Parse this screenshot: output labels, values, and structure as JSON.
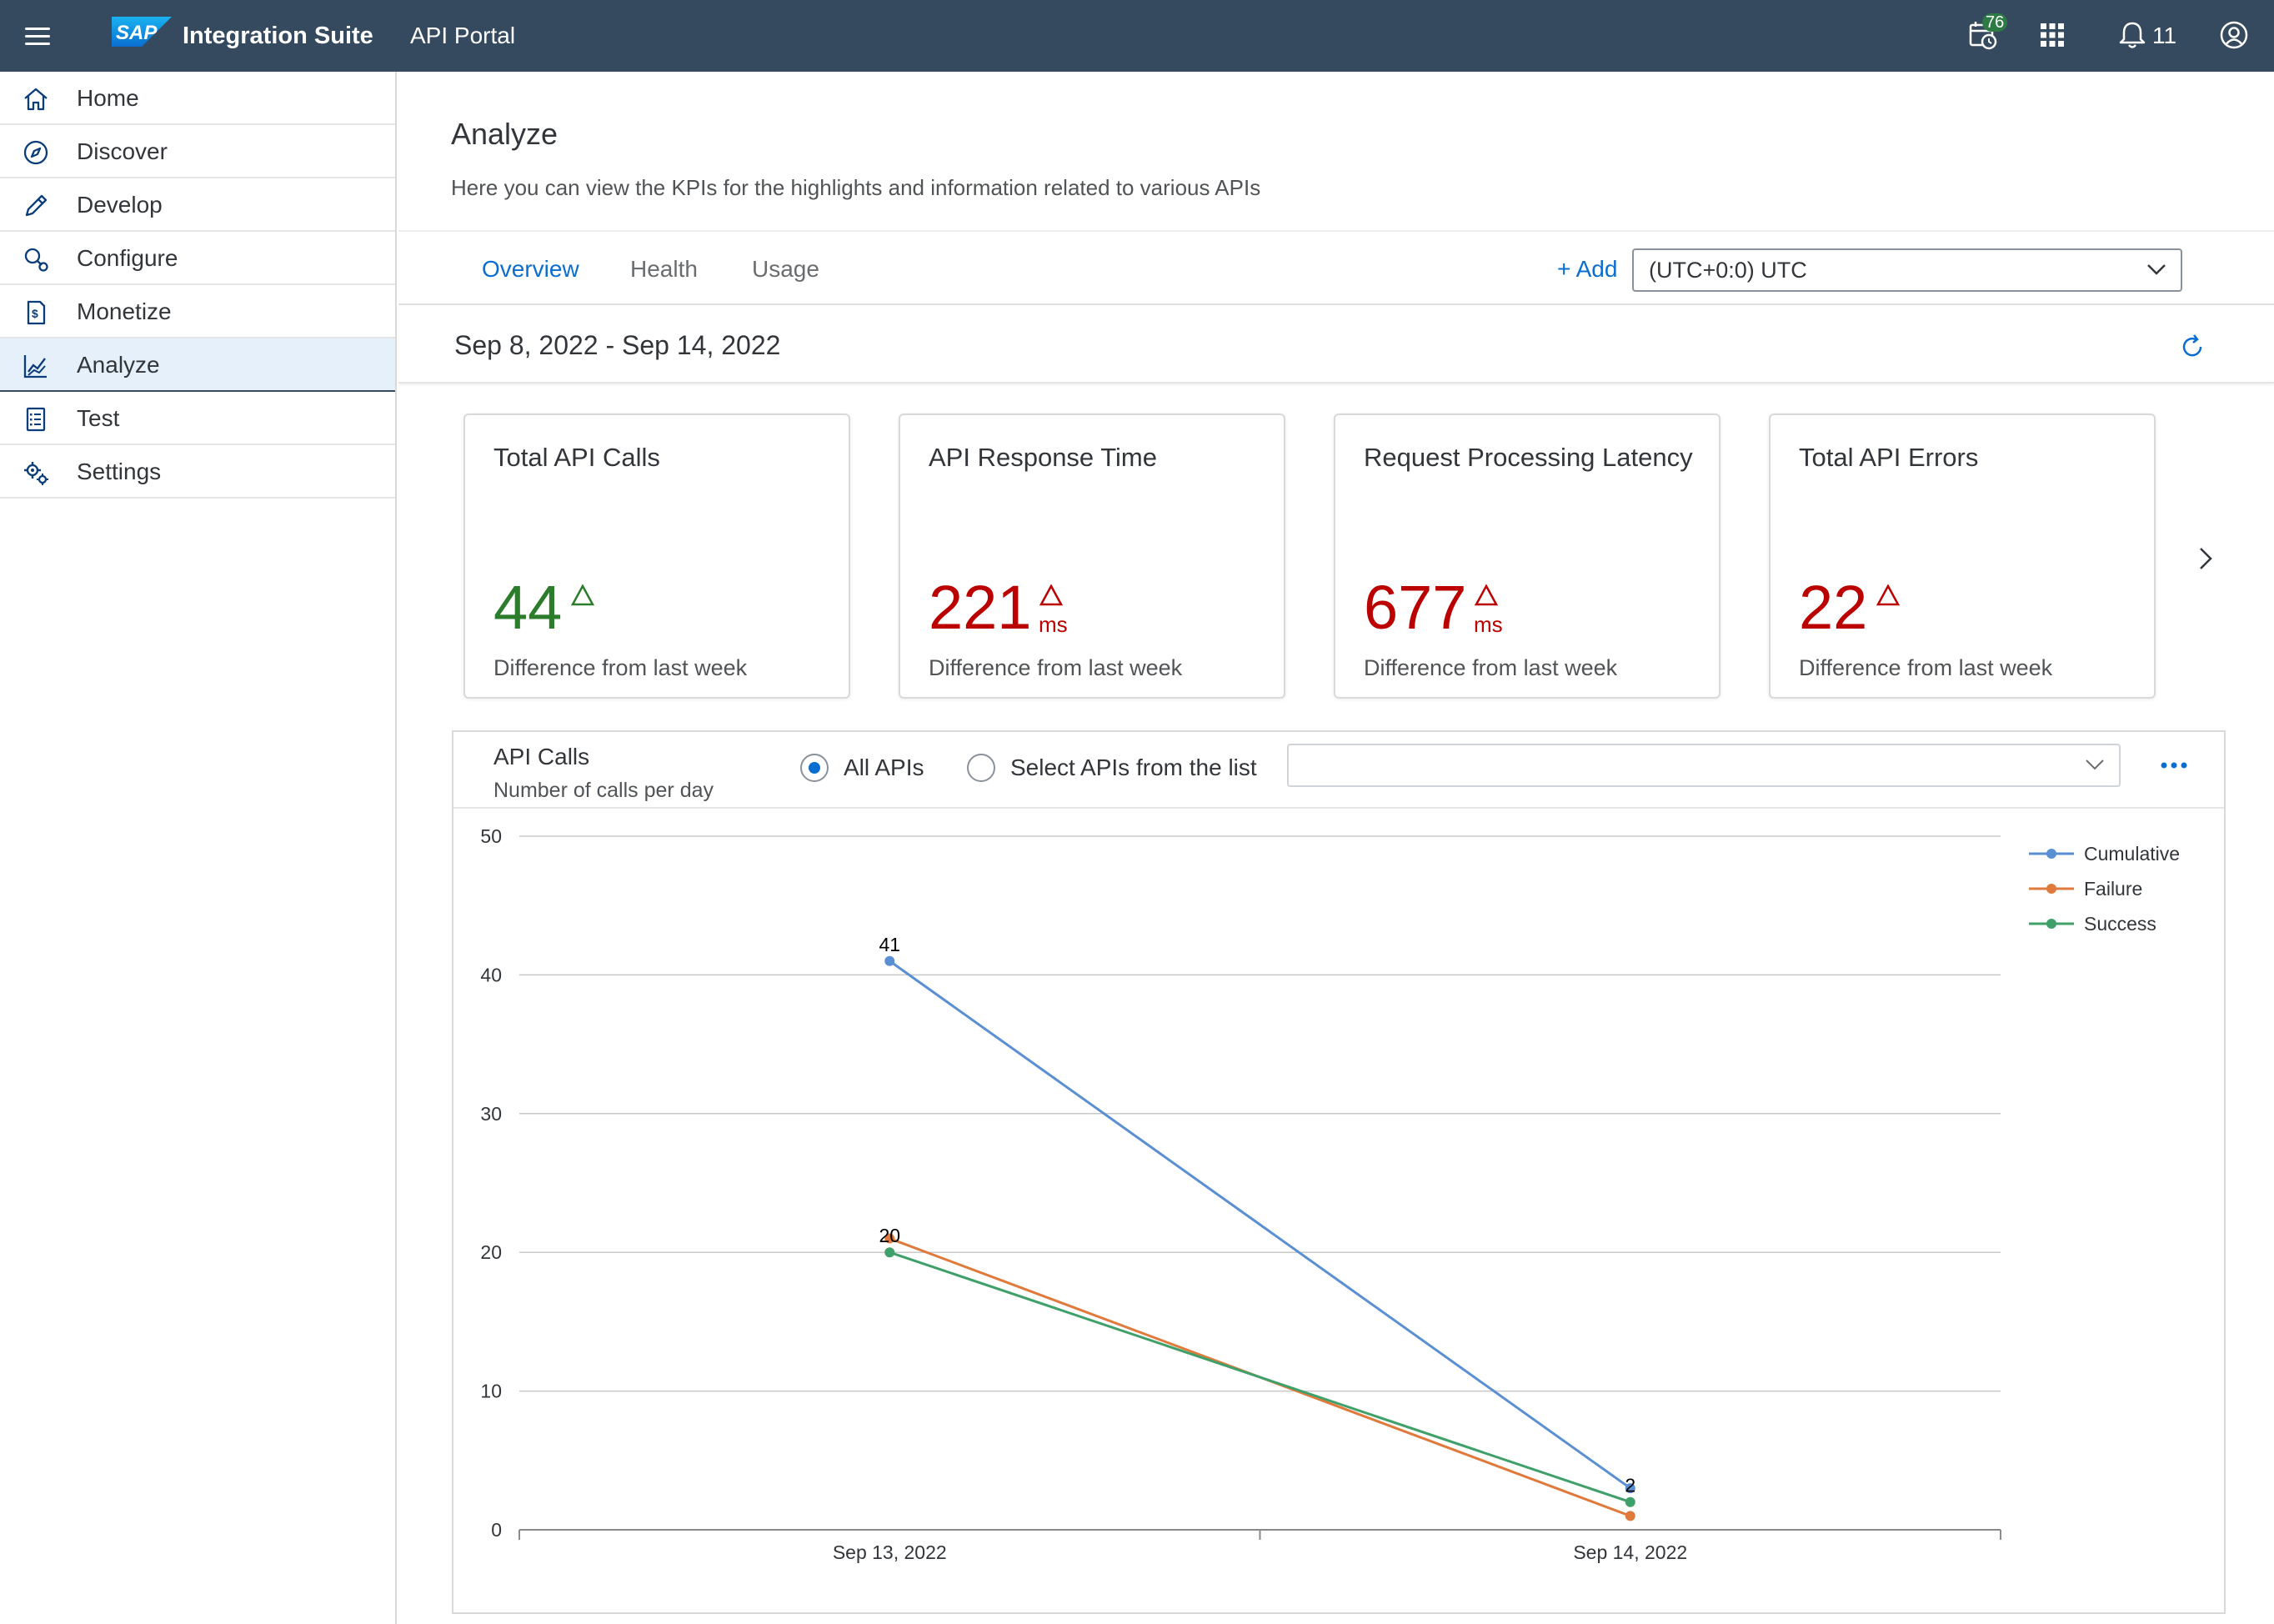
{
  "shell": {
    "product": "Integration Suite",
    "section": "API Portal",
    "calendar_badge": "76",
    "notification_count": "11",
    "icons": [
      "menu-icon",
      "sap-logo",
      "calendar-clock-icon",
      "app-grid-icon",
      "bell-icon",
      "user-account-icon"
    ]
  },
  "sidebar": {
    "items": [
      {
        "label": "Home",
        "icon": "home-icon"
      },
      {
        "label": "Discover",
        "icon": "compass-icon"
      },
      {
        "label": "Develop",
        "icon": "pencil-icon"
      },
      {
        "label": "Configure",
        "icon": "search-gear-icon"
      },
      {
        "label": "Monetize",
        "icon": "money-document-icon"
      },
      {
        "label": "Analyze",
        "icon": "line-chart-icon",
        "active": true
      },
      {
        "label": "Test",
        "icon": "checklist-icon"
      },
      {
        "label": "Settings",
        "icon": "gears-icon"
      }
    ]
  },
  "page": {
    "title": "Analyze",
    "description": "Here you can view the KPIs for the highlights and information related to various APIs",
    "tabs": [
      {
        "label": "Overview",
        "active": true
      },
      {
        "label": "Health"
      },
      {
        "label": "Usage"
      }
    ],
    "add_label": "+ Add",
    "timezone": "(UTC+0:0) UTC",
    "date_range": "Sep 8, 2022 - Sep 14, 2022"
  },
  "kpis": [
    {
      "title": "Total API Calls",
      "value": "44",
      "unit": "",
      "trend": "up",
      "color": "#2b7c2b",
      "subtitle": "Difference from last week"
    },
    {
      "title": "API Response Time",
      "value": "221",
      "unit": "ms",
      "trend": "up",
      "color": "#bb0000",
      "subtitle": "Difference from last week"
    },
    {
      "title": "Request Processing Latency",
      "value": "677",
      "unit": "ms",
      "trend": "up",
      "color": "#bb0000",
      "subtitle": "Difference from last week"
    },
    {
      "title": "Total API Errors",
      "value": "22",
      "unit": "",
      "trend": "up",
      "color": "#bb0000",
      "subtitle": "Difference from last week"
    }
  ],
  "chart_panel": {
    "title": "API Calls",
    "subtitle": "Number of calls per day",
    "radio_all": "All APIs",
    "radio_select": "Select APIs from the list",
    "select_value": ""
  },
  "chart_data": {
    "type": "line",
    "title": "",
    "xlabel": "",
    "ylabel": "",
    "categories": [
      "Sep 13, 2022",
      "Sep 14, 2022"
    ],
    "ylim": [
      0,
      50
    ],
    "yticks": [
      0,
      10,
      20,
      30,
      40,
      50
    ],
    "grid": true,
    "legend_position": "top-right",
    "series": [
      {
        "name": "Cumulative",
        "values": [
          41,
          3
        ],
        "color": "#5b8fd4",
        "labels": [
          "41",
          ""
        ]
      },
      {
        "name": "Failure",
        "values": [
          21,
          1
        ],
        "color": "#e07a3c",
        "labels": [
          "",
          ""
        ]
      },
      {
        "name": "Success",
        "values": [
          20,
          2
        ],
        "color": "#3fa06a",
        "labels": [
          "20",
          "2"
        ]
      }
    ]
  }
}
